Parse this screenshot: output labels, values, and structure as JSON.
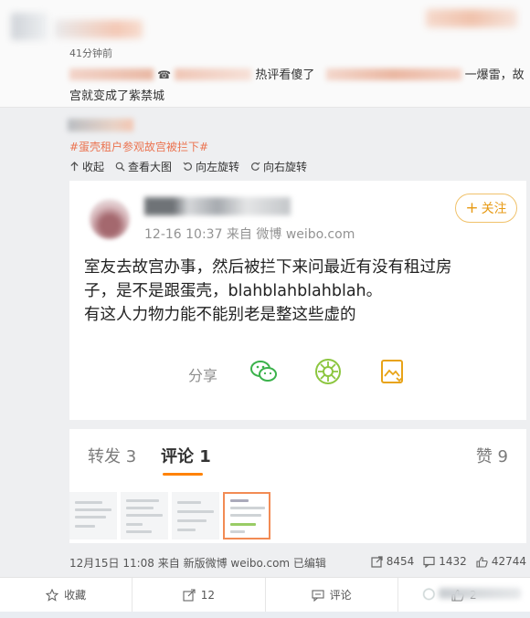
{
  "top_post": {
    "time": "41分钟前",
    "text_line1_part1": "热评看傻了",
    "text_line1_part2": "一爆雷，故",
    "text_line2": "宫就变成了紫禁城"
  },
  "repost": {
    "hashtag": "#蛋壳租户参观故宫被拦下#",
    "toolbar": [
      {
        "icon": "collapse-icon",
        "label": "收起"
      },
      {
        "icon": "view-large-icon",
        "label": "查看大图"
      },
      {
        "icon": "rotate-left-icon",
        "label": "向左旋转"
      },
      {
        "icon": "rotate-right-icon",
        "label": "向右旋转"
      }
    ],
    "screenshot": {
      "meta": "12-16 10:37  来自 微博 weibo.com",
      "follow_label": "关注",
      "body_line1": "室友去故宫办事，然后被拦下来问最近有没有租过房",
      "body_line2": "子，是不是跟蛋壳，blahblahblahblah。",
      "body_line3": "有这人力物力能不能别老是整这些虚的",
      "share_label": "分享",
      "tabs": {
        "repost": "转发 3",
        "comment": "评论 1",
        "like": "赞 9"
      }
    },
    "meta": "12月15日 11:08 来自 新版微博 weibo.com  已编辑",
    "stats": {
      "reposts": "8454",
      "comments": "1432",
      "likes": "42744"
    }
  },
  "bottom_bar": {
    "favorite": "收藏",
    "repost": "12",
    "comment": "评论",
    "like": "2"
  },
  "colors": {
    "accent_orange": "#ff8200",
    "hashtag": "#eb7350",
    "follow_border": "#f0c26b"
  }
}
